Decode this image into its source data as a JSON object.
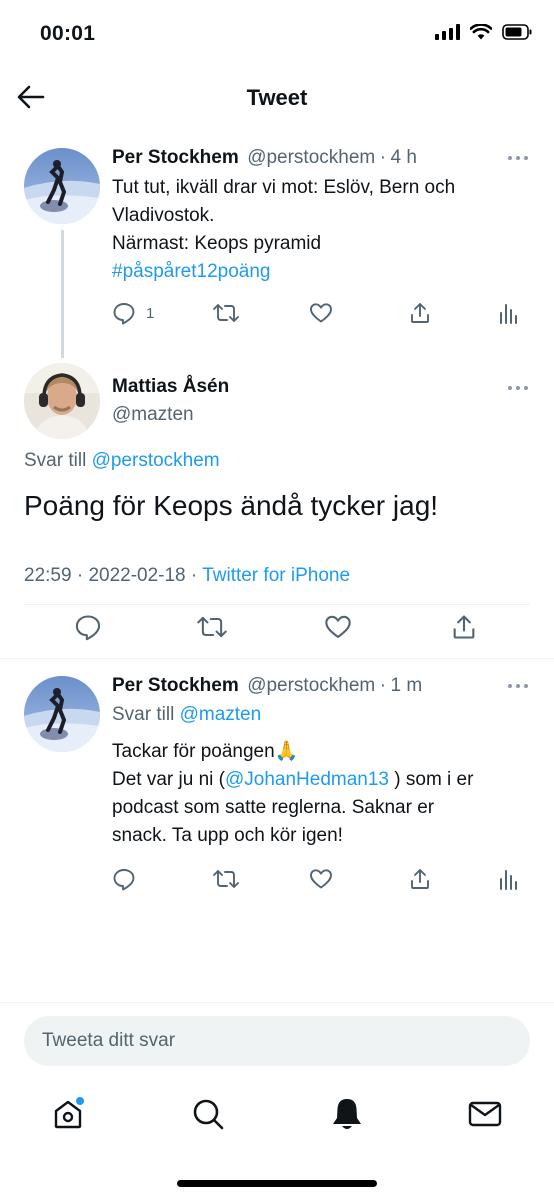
{
  "status_bar": {
    "time": "00:01"
  },
  "header": {
    "title": "Tweet"
  },
  "thread": {
    "parent": {
      "name": "Per Stockhem",
      "handle": "@perstockhem",
      "separator": "·",
      "time": "4 h",
      "lines": [
        "Tut tut, ikväll drar vi mot: Eslöv, Bern och",
        "Vladivostok.",
        "Närmast: Keops pyramid"
      ],
      "hashtag": "#påspåret12poäng",
      "reply_count": "1"
    },
    "focused": {
      "name": "Mattias Åsén",
      "handle": "@mazten",
      "reply_prefix": "Svar till",
      "reply_to": "@perstockhem",
      "text": "Poäng för Keops ändå tycker jag!",
      "time": "22:59",
      "date": "2022-02-18",
      "separator": "·",
      "source": "Twitter for iPhone"
    },
    "reply": {
      "name": "Per Stockhem",
      "handle": "@perstockhem",
      "separator": "·",
      "time": "1 m",
      "reply_prefix": "Svar till",
      "reply_to": "@mazten",
      "line1": "Tackar för poängen🙏",
      "line2_prefix": "Det var ju ni (",
      "line2_mention": "@JohanHedman13",
      "line2_suffix": " ) som i er",
      "line3": "podcast som satte reglerna. Saknar er",
      "line4": "snack. Ta upp och kör igen!"
    }
  },
  "reply_bar": {
    "placeholder": "Tweeta ditt svar"
  },
  "colors": {
    "link": "#1d9bf0",
    "secondary": "#536471",
    "divider": "#eff3f4",
    "notification_dot": "#1d9bf0"
  },
  "icons": [
    "back-arrow-icon",
    "reply-icon",
    "retweet-icon",
    "like-icon",
    "share-icon",
    "analytics-icon",
    "home-icon",
    "search-icon",
    "bell-icon",
    "mail-icon"
  ]
}
